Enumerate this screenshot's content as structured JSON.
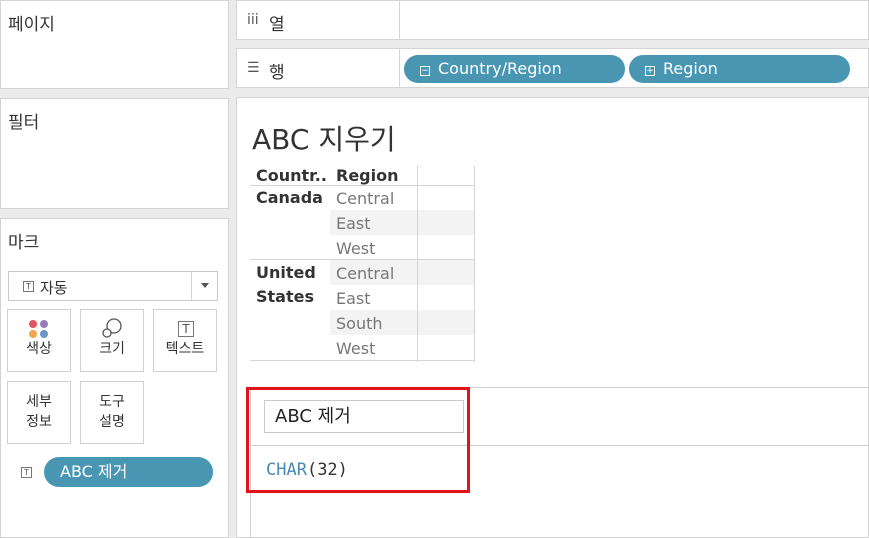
{
  "left": {
    "pages_title": "페이지",
    "filters_title": "필터",
    "marks_title": "마크",
    "mark_type": "자동",
    "cards": {
      "color": "색상",
      "size": "크기",
      "text": "텍스트",
      "detail_1": "세부",
      "detail_2": "정보",
      "tooltip_1": "도구",
      "tooltip_2": "설명"
    },
    "mark_pill": "ABC 제거"
  },
  "shelves": {
    "columns_label": "열",
    "rows_label": "행",
    "row_pills": [
      "Country/Region",
      "Region"
    ]
  },
  "view": {
    "title": "ABC 지우기",
    "table": {
      "headers": [
        "Countr..",
        "Region"
      ],
      "rows": [
        {
          "country": "Canada",
          "regions": [
            "Central",
            "East",
            "West"
          ]
        },
        {
          "country_line1": "United",
          "country_line2": "States",
          "regions": [
            "Central",
            "East",
            "South",
            "West"
          ]
        }
      ]
    }
  },
  "calc": {
    "name": "ABC 제거",
    "formula_fn": "CHAR",
    "formula_args": "(32)"
  },
  "colors": {
    "pill": "#4996b2",
    "highlight": "#e0131a",
    "function": "#4a8ab0"
  }
}
